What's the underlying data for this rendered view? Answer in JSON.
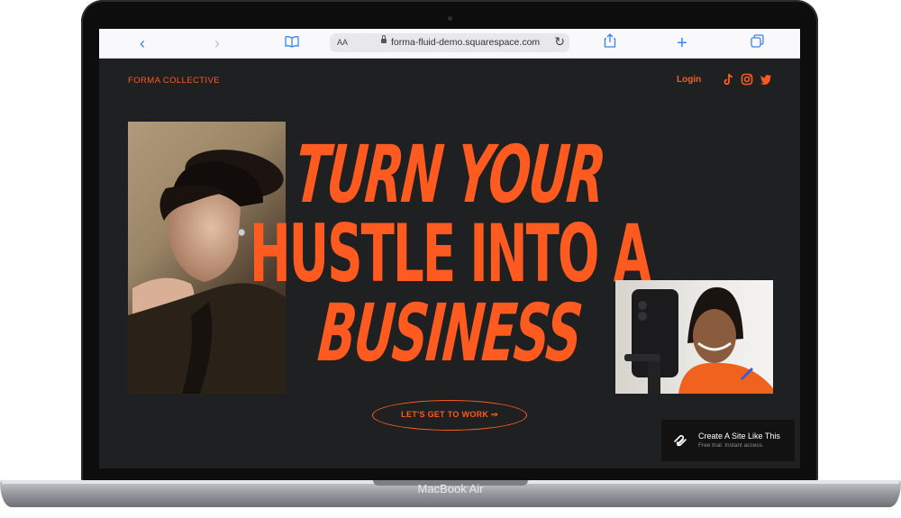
{
  "device": {
    "brand": "MacBook Air"
  },
  "browser": {
    "url": "forma-fluid-demo.squarespace.com",
    "aa_label": "AA",
    "icons": [
      "back-icon",
      "forward-icon",
      "bookmarks-icon",
      "lock-icon",
      "reload-icon",
      "share-icon",
      "new-tab-icon",
      "tabs-icon"
    ]
  },
  "site": {
    "title": "FORMA COLLECTIVE",
    "login": "Login",
    "social": [
      "tiktok-icon",
      "instagram-icon",
      "twitter-icon"
    ],
    "accent": "#ff5a1f",
    "background": "#1f2022"
  },
  "hero": {
    "line1": "TURN YOUR",
    "line2": "HUSTLE INTO A",
    "line3": "BUSINESS"
  },
  "cta": {
    "label": "LET'S GET TO WORK ⇒"
  },
  "squarespace_badge": {
    "title": "Create A Site Like This",
    "subtitle": "Free trial. Instant access."
  }
}
